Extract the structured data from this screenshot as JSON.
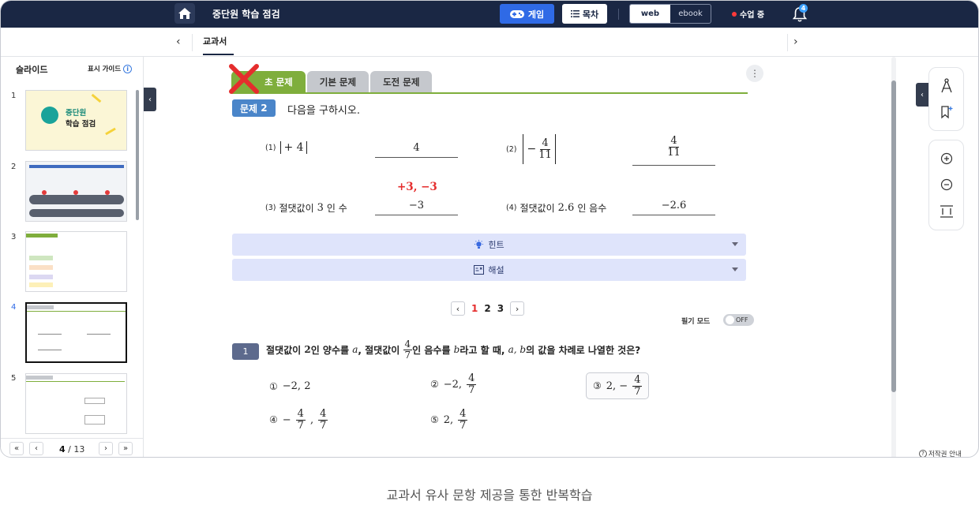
{
  "header": {
    "title": "중단원 학습 점검",
    "game_label": "게임",
    "toc_label": "목차",
    "view_web": "web",
    "view_ebook": "ebook",
    "live_label": "수업 중",
    "notifications": "4"
  },
  "tabbar": {
    "tab": "교과서"
  },
  "sidebar": {
    "title": "슬라이드",
    "guide": "표시 가이드",
    "thumbnails": [
      {
        "num": "1",
        "line1": "중단원",
        "line2": "학습 점검"
      },
      {
        "num": "2"
      },
      {
        "num": "3"
      },
      {
        "num": "4"
      },
      {
        "num": "5"
      }
    ],
    "pager": {
      "current": "4",
      "total": "/ 13"
    }
  },
  "content": {
    "tabs": [
      "기초 문제",
      "기본 문제",
      "도전 문제"
    ],
    "tab_first_visible": "초 문제",
    "problem": {
      "badge": "문제",
      "num": "2",
      "instruction": "다음을 구하시오."
    },
    "items": {
      "i1": {
        "idx": "(1)",
        "expr": "+ 4",
        "answer": "4"
      },
      "i2": {
        "idx": "(2)",
        "sign": "−",
        "num": "4",
        "den": "11",
        "ans_num": "4",
        "ans_den": "11"
      },
      "i3": {
        "idx": "(3)",
        "t1": "절댓값이",
        "val": "3",
        "t2": "인 수",
        "red": "+3, −3",
        "answer": "−3"
      },
      "i4": {
        "idx": "(4)",
        "t1": "절댓값이",
        "val": "2.6",
        "t2": "인 음수",
        "answer": "−2.6"
      }
    },
    "hint": "힌트",
    "explain": "해설",
    "pages": [
      "1",
      "2",
      "3"
    ],
    "pen_mode": "필기 모드",
    "pen_state": "OFF",
    "question": {
      "num": "1",
      "t1": "절댓값이",
      "v1": "2",
      "t2": "인 양수를",
      "a": "a",
      "t3": ", 절댓값이",
      "fn": "4",
      "fd": "7",
      "t4": "인 음수를",
      "b": "b",
      "t5": "라고 할 때,",
      "ab": "a, b",
      "t6": "의 값을 차례로 나열한 것은?"
    },
    "choices": {
      "c1": {
        "mark": "①",
        "text": "−2, 2"
      },
      "c2": {
        "mark": "②",
        "pre": "−2,",
        "n": "4",
        "d": "7"
      },
      "c3": {
        "mark": "③",
        "pre": "2, −",
        "n": "4",
        "d": "7"
      },
      "c4": {
        "mark": "④",
        "pre": "−",
        "n1": "4",
        "d1": "7",
        "n2": "4",
        "d2": "7"
      },
      "c5": {
        "mark": "⑤",
        "pre": "2,",
        "n": "4",
        "d": "7"
      }
    }
  },
  "copyright": "저작권 안내",
  "caption": "교과서 유사 문항 제공을 통한 반복학습",
  "colors": {
    "navy": "#1a2744",
    "blue": "#2f6ae6",
    "green": "#7fae3c",
    "red": "#e52d2d"
  }
}
